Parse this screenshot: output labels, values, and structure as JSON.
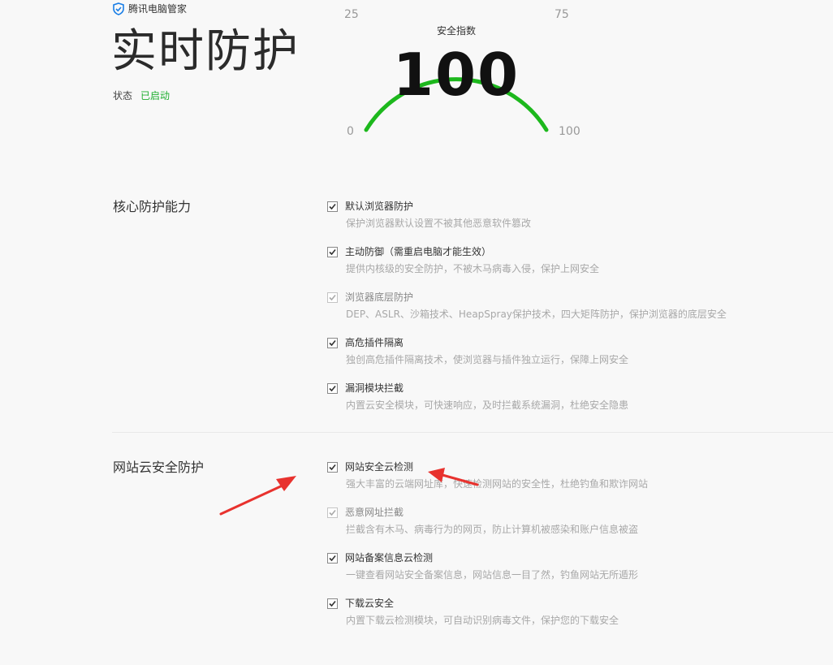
{
  "brand": {
    "name": "腾讯电脑管家",
    "icon": "shield-check-icon",
    "color": "#1a7ee6"
  },
  "header": {
    "title": "实时防护",
    "status_label": "状态",
    "status_value": "已启动",
    "status_color": "#1fae30"
  },
  "gauge": {
    "label": "安全指数",
    "score": "100",
    "ticks": {
      "t0": "0",
      "t25": "25",
      "t75": "75",
      "t100": "100"
    },
    "arc_color": "#1db81d",
    "value": 100
  },
  "sections": [
    {
      "title": "核心防护能力",
      "options": [
        {
          "title": "默认浏览器防护",
          "desc": "保护浏览器默认设置不被其他恶意软件篡改",
          "checked": true,
          "disabled": false
        },
        {
          "title": "主动防御（需重启电脑才能生效）",
          "desc": "提供内核级的安全防护，不被木马病毒入侵，保护上网安全",
          "checked": true,
          "disabled": false
        },
        {
          "title": "浏览器底层防护",
          "desc": "DEP、ASLR、沙箱技术、HeapSpray保护技术，四大矩阵防护，保护浏览器的底层安全",
          "checked": true,
          "disabled": true
        },
        {
          "title": "高危插件隔离",
          "desc": "独创高危插件隔离技术，使浏览器与插件独立运行，保障上网安全",
          "checked": true,
          "disabled": false
        },
        {
          "title": "漏洞模块拦截",
          "desc": "内置云安全模块，可快速响应，及时拦截系统漏洞，杜绝安全隐患",
          "checked": true,
          "disabled": false
        }
      ]
    },
    {
      "title": "网站云安全防护",
      "options": [
        {
          "title": "网站安全云检测",
          "desc": "强大丰富的云端网址库，快速检测网站的安全性，杜绝钓鱼和欺诈网站",
          "checked": true,
          "disabled": false
        },
        {
          "title": "恶意网址拦截",
          "desc": "拦截含有木马、病毒行为的网页，防止计算机被感染和账户信息被盗",
          "checked": true,
          "disabled": true
        },
        {
          "title": "网站备案信息云检测",
          "desc": "一键查看网站安全备案信息，网站信息一目了然，钓鱼网站无所遁形",
          "checked": true,
          "disabled": false
        },
        {
          "title": "下载云安全",
          "desc": "内置下载云检测模块，可自动识别病毒文件，保护您的下载安全",
          "checked": true,
          "disabled": false
        }
      ]
    }
  ],
  "annotation_color": "#e8322e"
}
